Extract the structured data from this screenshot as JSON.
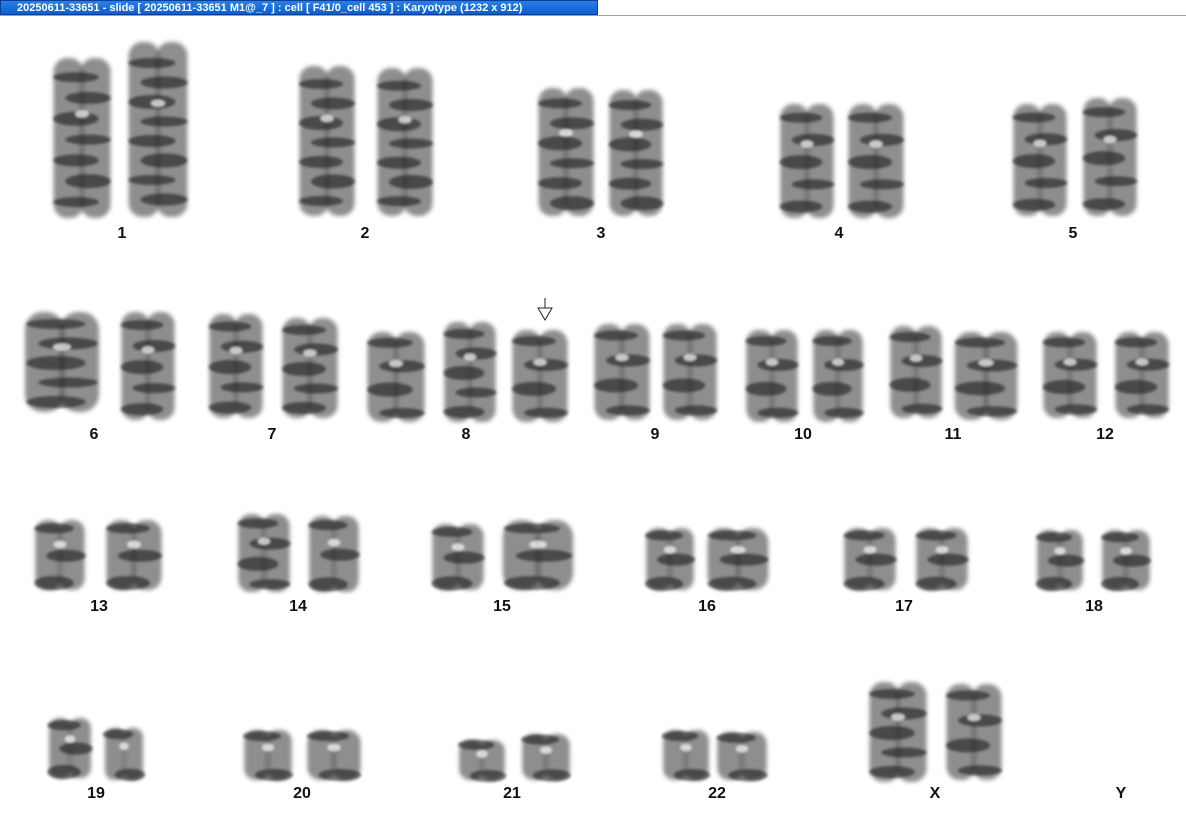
{
  "window": {
    "title": "20250611-33651 - slide [ 20250611-33651 M1@_7 ] : cell [ F41/0_cell 453 ] : Karyotype  (1232 x 912)"
  },
  "karyotype": {
    "labels": [
      "1",
      "2",
      "3",
      "4",
      "5",
      "6",
      "7",
      "8",
      "9",
      "10",
      "11",
      "12",
      "13",
      "14",
      "15",
      "16",
      "17",
      "18",
      "19",
      "20",
      "21",
      "22",
      "X",
      "Y"
    ]
  },
  "icons": {
    "marker": "down-arrow-marker-icon"
  },
  "colors": {
    "titlebar": "#0b5fd0",
    "chromosome": "#303030",
    "band_dark": "#1a1a1a",
    "background": "#ffffff"
  }
}
